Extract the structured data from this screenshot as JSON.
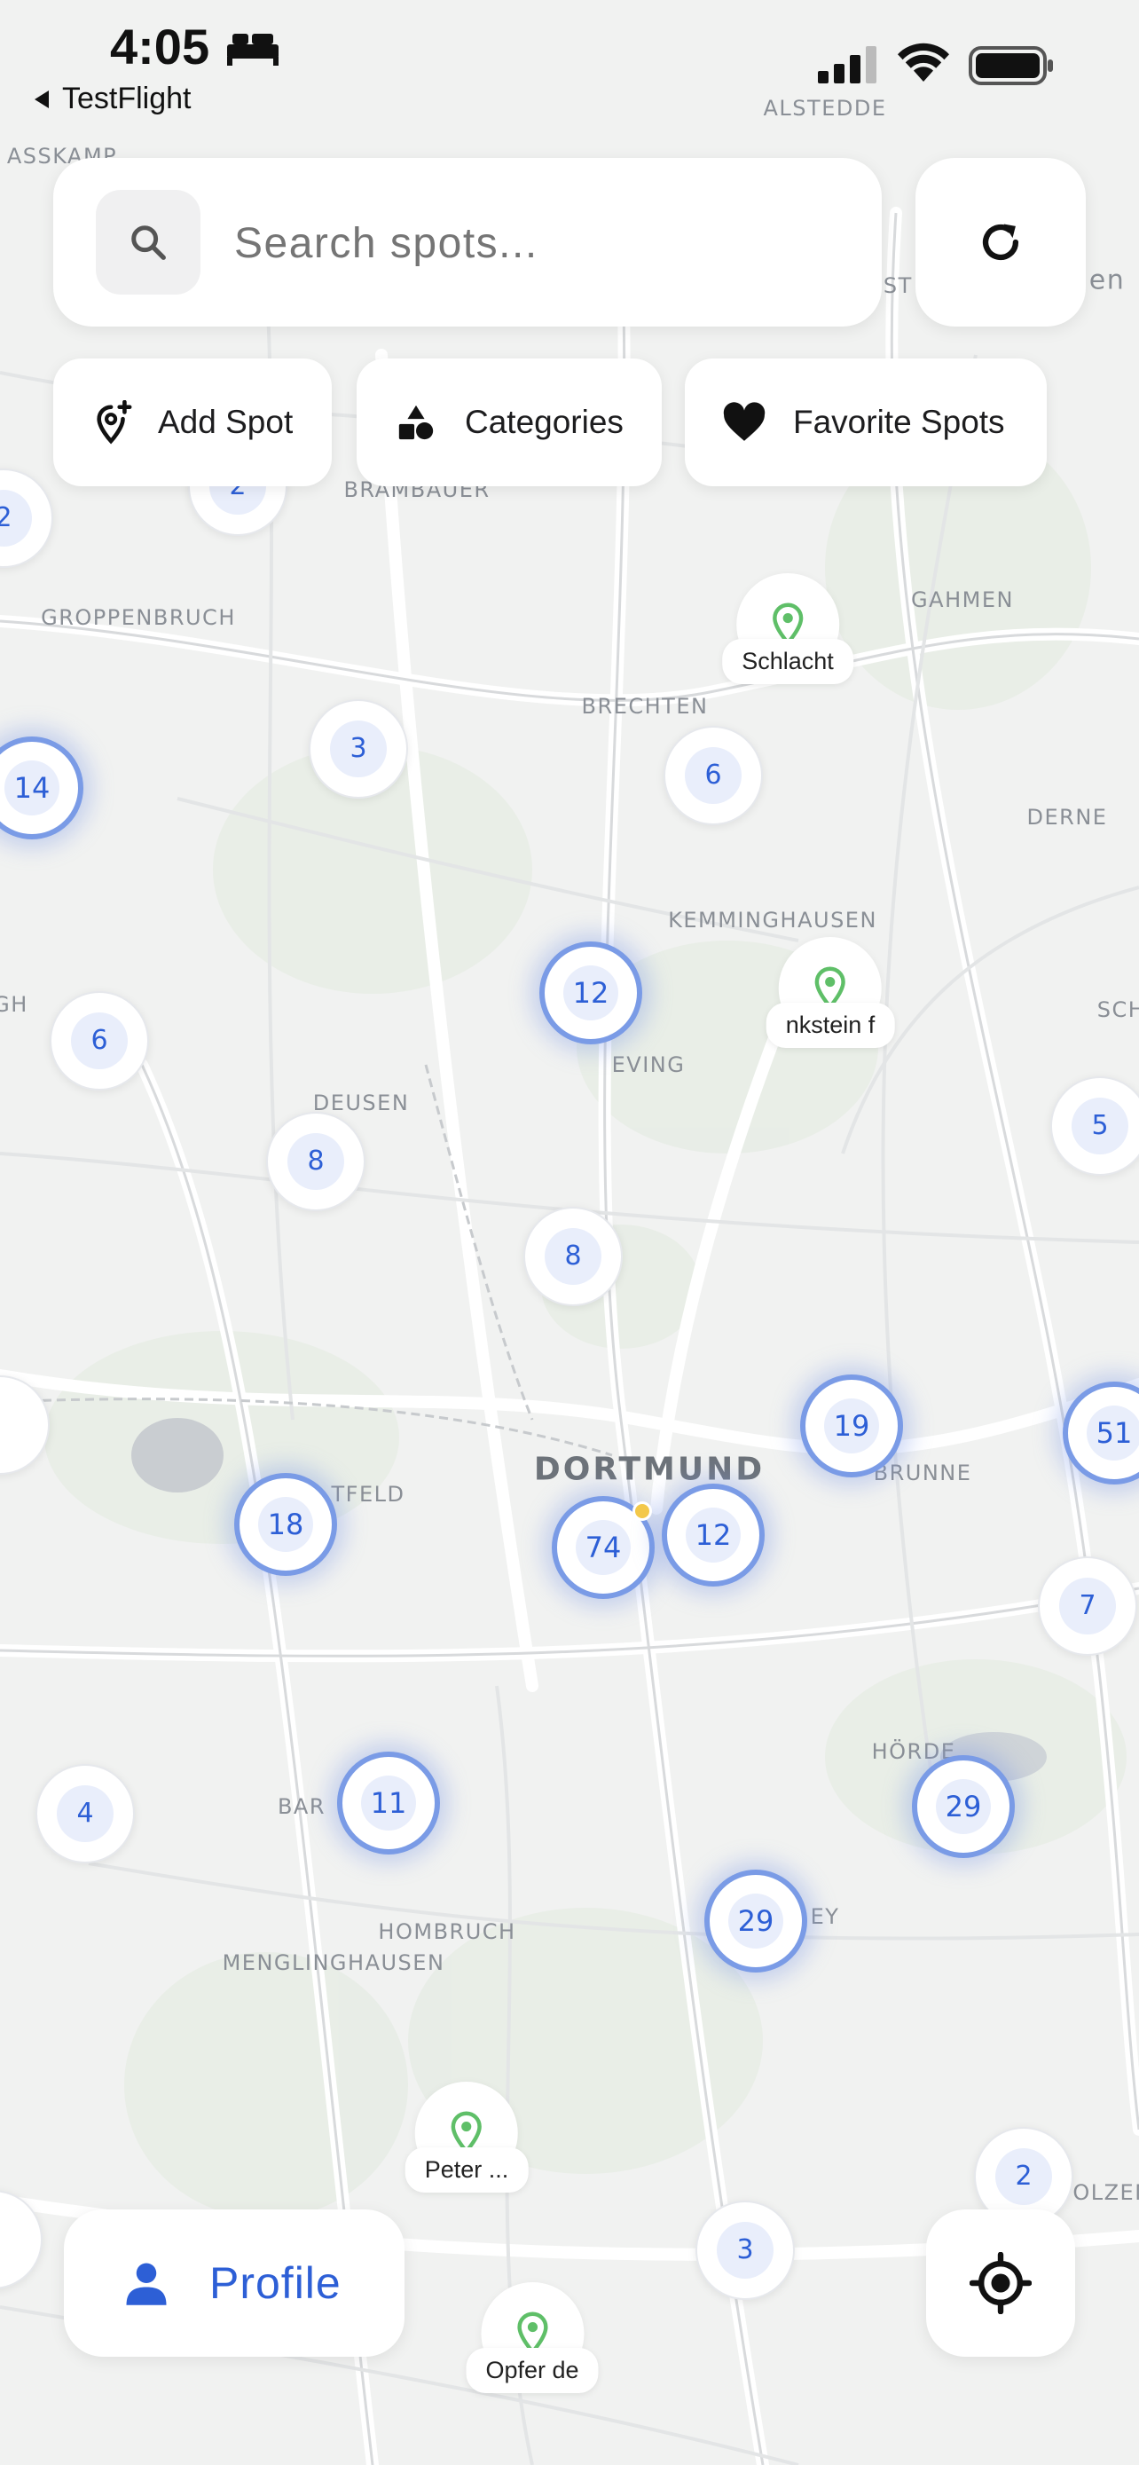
{
  "status_bar": {
    "time": "4:05",
    "back_app": "TestFlight"
  },
  "search": {
    "placeholder": "Search spots..."
  },
  "filters": [
    {
      "label": "Add Spot",
      "icon": "add-location-icon"
    },
    {
      "label": "Categories",
      "icon": "shapes-icon"
    },
    {
      "label": "Favorite Spots",
      "icon": "heart-icon"
    }
  ],
  "map_labels": [
    "ALSTEDDE",
    "ASSKAMP",
    "BRAMBAUER",
    "GROPPENBRUCH",
    "GAHMEN",
    "BRECHTEN",
    "DERNE",
    "KEMMINGHAUSEN",
    "EVING",
    "DEUSEN",
    "DORTMUND",
    "BRUNNE",
    "HÖRDE",
    "HOMBRUCH",
    "MENGLINGHAUSEN",
    "BAR",
    "TFELD",
    "EY",
    "SCH",
    "GH",
    "IST",
    "en",
    "OLZEN"
  ],
  "clusters": [
    "2",
    "2",
    "14",
    "3",
    "6",
    "12",
    "6",
    "8",
    "8",
    "5",
    "19",
    "51",
    "18",
    "74",
    "12",
    "7",
    "11",
    "4",
    "29",
    "29",
    "2",
    "3"
  ],
  "pois": [
    {
      "label": "Schlacht"
    },
    {
      "label": "nkstein f"
    },
    {
      "label": "Peter ..."
    },
    {
      "label": "Opfer de"
    }
  ],
  "profile_button": {
    "label": "Profile",
    "icon": "person-icon"
  },
  "locate_button": {
    "icon": "crosshair-icon"
  },
  "refresh_button": {
    "icon": "refresh-icon"
  },
  "colors": {
    "accent": "#2d5fd6",
    "pin": "#5fbf68",
    "cluster_ring": "#7a9be6"
  }
}
